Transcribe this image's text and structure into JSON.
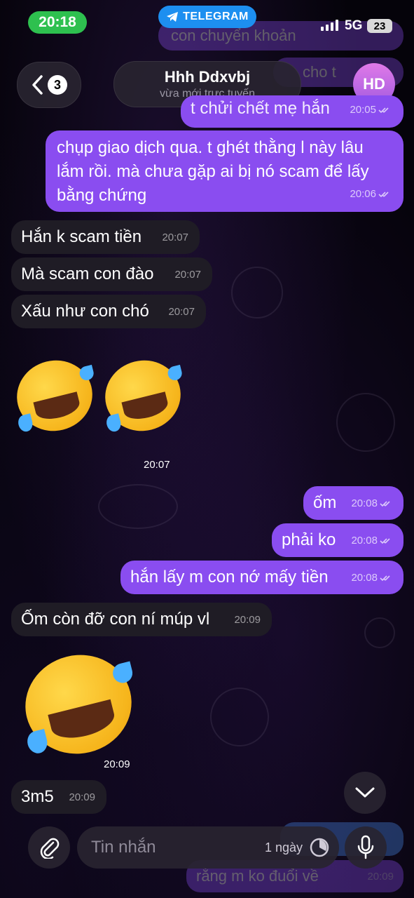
{
  "status_bar": {
    "time": "20:18",
    "app_pill": "TELEGRAM",
    "network": "5G",
    "battery": "23"
  },
  "header": {
    "back_badge": "3",
    "contact_name": "Hhh Ddxvbj",
    "contact_status": "vừa mới trực tuyến",
    "avatar_initials": "HD"
  },
  "messages": [
    {
      "dir": "out",
      "text": "t chửi chết mẹ hắn",
      "time": "20:05"
    },
    {
      "dir": "out",
      "text": "chụp giao dịch qua. t ghét thằng l này lâu lắm rồi. mà chưa gặp ai bị nó scam để lấy bằng chứng",
      "time": "20:06"
    },
    {
      "dir": "in",
      "text": "Hắn k scam tiền",
      "time": "20:07"
    },
    {
      "dir": "in",
      "text": "Mà scam con đào",
      "time": "20:07"
    },
    {
      "dir": "in",
      "text": "Xấu như con chó",
      "time": "20:07"
    },
    {
      "dir": "in",
      "emoji": "rofl-rofl",
      "time": "20:07"
    },
    {
      "dir": "out",
      "text": "ốm",
      "time": "20:08"
    },
    {
      "dir": "out",
      "text": "phải ko",
      "time": "20:08"
    },
    {
      "dir": "out",
      "text": "hắn lấy m con nớ mấy tiền",
      "time": "20:08"
    },
    {
      "dir": "in",
      "text": "Ốm còn đỡ con ní múp vl",
      "time": "20:09"
    },
    {
      "dir": "in",
      "emoji": "rofl",
      "time": "20:09"
    },
    {
      "dir": "in",
      "text": "3m5",
      "time": "20:09"
    }
  ],
  "ghost_top": [
    "con chuyển khoản",
    "cho t"
  ],
  "ghost_bottom": {
    "text": "rằng m ko đuổi về",
    "time": "20:09"
  },
  "composer": {
    "placeholder": "Tin nhắn",
    "timer_label": "1 ngày"
  },
  "colors": {
    "outgoing": "#8a4df0",
    "incoming": "#1f1c25",
    "time_pill": "#2ec04f",
    "telegram_pill": "#1d8ff0"
  }
}
